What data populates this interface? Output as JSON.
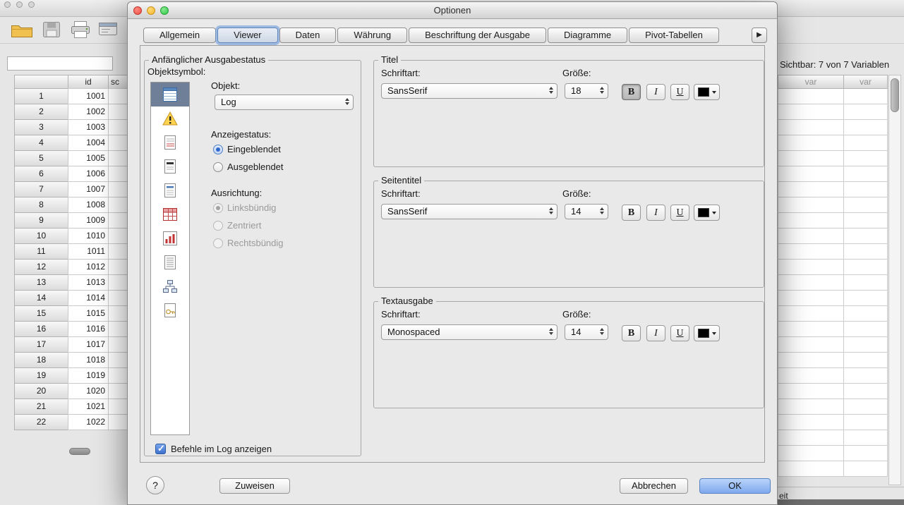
{
  "background": {
    "left_window": {
      "window_controls": [
        "close",
        "minimize",
        "zoom"
      ],
      "toolbar_icons": [
        "open-file",
        "save",
        "print",
        "recall-dialog"
      ],
      "cell_editor_value": "",
      "table": {
        "corner_header": "",
        "column_headers": [
          "id",
          "sc"
        ],
        "rows": [
          {
            "n": "1",
            "id": "1001"
          },
          {
            "n": "2",
            "id": "1002"
          },
          {
            "n": "3",
            "id": "1003"
          },
          {
            "n": "4",
            "id": "1004"
          },
          {
            "n": "5",
            "id": "1005"
          },
          {
            "n": "6",
            "id": "1006"
          },
          {
            "n": "7",
            "id": "1007"
          },
          {
            "n": "8",
            "id": "1008"
          },
          {
            "n": "9",
            "id": "1009"
          },
          {
            "n": "10",
            "id": "1010"
          },
          {
            "n": "11",
            "id": "1011"
          },
          {
            "n": "12",
            "id": "1012"
          },
          {
            "n": "13",
            "id": "1013"
          },
          {
            "n": "14",
            "id": "1014"
          },
          {
            "n": "15",
            "id": "1015"
          },
          {
            "n": "16",
            "id": "1016"
          },
          {
            "n": "17",
            "id": "1017"
          },
          {
            "n": "18",
            "id": "1018"
          },
          {
            "n": "19",
            "id": "1019"
          },
          {
            "n": "20",
            "id": "1020"
          },
          {
            "n": "21",
            "id": "1021"
          },
          {
            "n": "22",
            "id": "1022"
          }
        ]
      }
    },
    "right_window": {
      "visible_info": "Sichtbar: 7 von 7 Variablen",
      "column_headers": [
        "var",
        "var"
      ],
      "status_partial": "eit"
    }
  },
  "dialog": {
    "title": "Optionen",
    "window_controls": [
      "close",
      "minimize",
      "zoom"
    ],
    "tabs": [
      {
        "label": "Allgemein",
        "active": false
      },
      {
        "label": "Viewer",
        "active": true
      },
      {
        "label": "Daten",
        "active": false
      },
      {
        "label": "Währung",
        "active": false
      },
      {
        "label": "Beschriftung der Ausgabe",
        "active": false
      },
      {
        "label": "Diagramme",
        "active": false
      },
      {
        "label": "Pivot-Tabellen",
        "active": false
      }
    ],
    "tab_overflow_arrow": "▶",
    "output_group": {
      "title": "Anfänglicher Ausgabestatus",
      "object_symbol_label": "Objektsymbol:",
      "object_icons": [
        "log",
        "warnings",
        "notes",
        "title",
        "page-title",
        "pivot-table",
        "chart",
        "text-output",
        "tree",
        "model"
      ],
      "selected_icon": "log",
      "object_label": "Objekt:",
      "object_value": "Log",
      "display_status_label": "Anzeigestatus:",
      "display_options": [
        {
          "label": "Eingeblendet",
          "selected": true,
          "disabled": false
        },
        {
          "label": "Ausgeblendet",
          "selected": false,
          "disabled": false
        }
      ],
      "alignment_label": "Ausrichtung:",
      "alignment_options": [
        {
          "label": "Linksbündig",
          "selected": true,
          "disabled": true
        },
        {
          "label": "Zentriert",
          "selected": false,
          "disabled": true
        },
        {
          "label": "Rechtsbündig",
          "selected": false,
          "disabled": true
        }
      ],
      "log_checkbox": {
        "label": "Befehle im Log anzeigen",
        "checked": true
      }
    },
    "font_groups": [
      {
        "id": "titel",
        "title": "Titel",
        "font_label": "Schriftart:",
        "font_value": "SansSerif",
        "size_label": "Größe:",
        "size_value": "18",
        "bold_active": true,
        "italic_active": false,
        "underline_active": false
      },
      {
        "id": "seitentitel",
        "title": "Seitentitel",
        "font_label": "Schriftart:",
        "font_value": "SansSerif",
        "size_label": "Größe:",
        "size_value": "14",
        "bold_active": false,
        "italic_active": false,
        "underline_active": false
      },
      {
        "id": "textausgabe",
        "title": "Textausgabe",
        "font_label": "Schriftart:",
        "font_value": "Monospaced",
        "size_label": "Größe:",
        "size_value": "14",
        "bold_active": false,
        "italic_active": false,
        "underline_active": false
      }
    ],
    "style_buttons": {
      "bold": "B",
      "italic": "I",
      "underline": "U"
    },
    "action_buttons": {
      "help": "?",
      "apply": "Zuweisen",
      "cancel": "Abbrechen",
      "ok": "OK"
    },
    "colors": {
      "ok_button": "#8ab4f0",
      "selected_icon_bg": "#6f7f97",
      "text_color_swatch": "#000000",
      "active_tab_ring": "#5e94da"
    }
  }
}
